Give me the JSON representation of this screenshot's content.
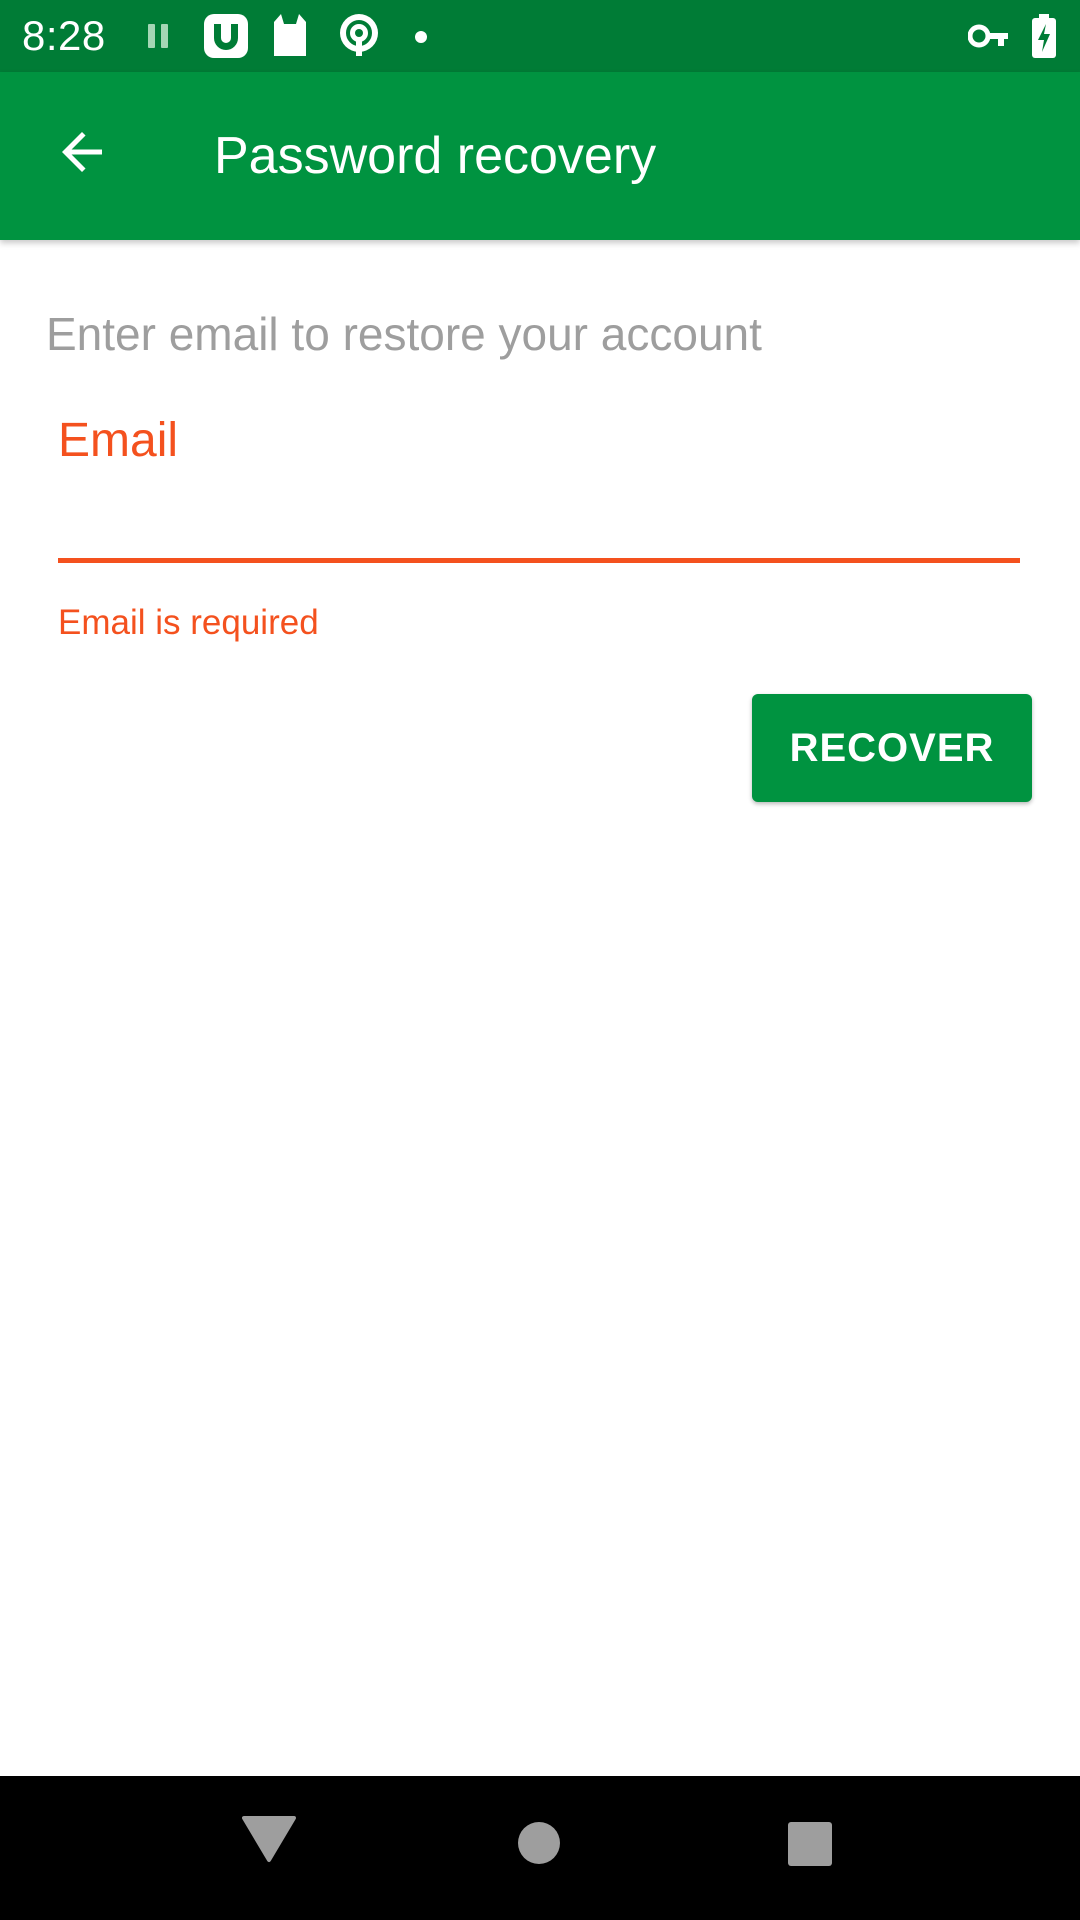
{
  "status_bar": {
    "time": "8:28",
    "left_icons": [
      "pause-icon",
      "app-icon-u",
      "cat-icon",
      "podcast-icon",
      "dot-icon"
    ],
    "right_icons": [
      "vpn-key-icon",
      "battery-charging-icon"
    ]
  },
  "app_bar": {
    "title": "Password recovery",
    "back_icon": "arrow-back-icon"
  },
  "form": {
    "subtitle": "Enter email to restore your account",
    "email_label": "Email",
    "email_value": "",
    "email_error": "Email is required",
    "submit_label": "RECOVER"
  },
  "nav_bar": {
    "buttons": [
      "back-triangle-icon",
      "home-circle-icon",
      "recents-square-icon"
    ]
  },
  "colors": {
    "status_bar": "#007C36",
    "app_bar": "#009340",
    "accent_error": "#F4511E",
    "subtitle_text": "#9e9e9e",
    "nav_bar": "#000000",
    "nav_icons": "#9e9e9e"
  }
}
